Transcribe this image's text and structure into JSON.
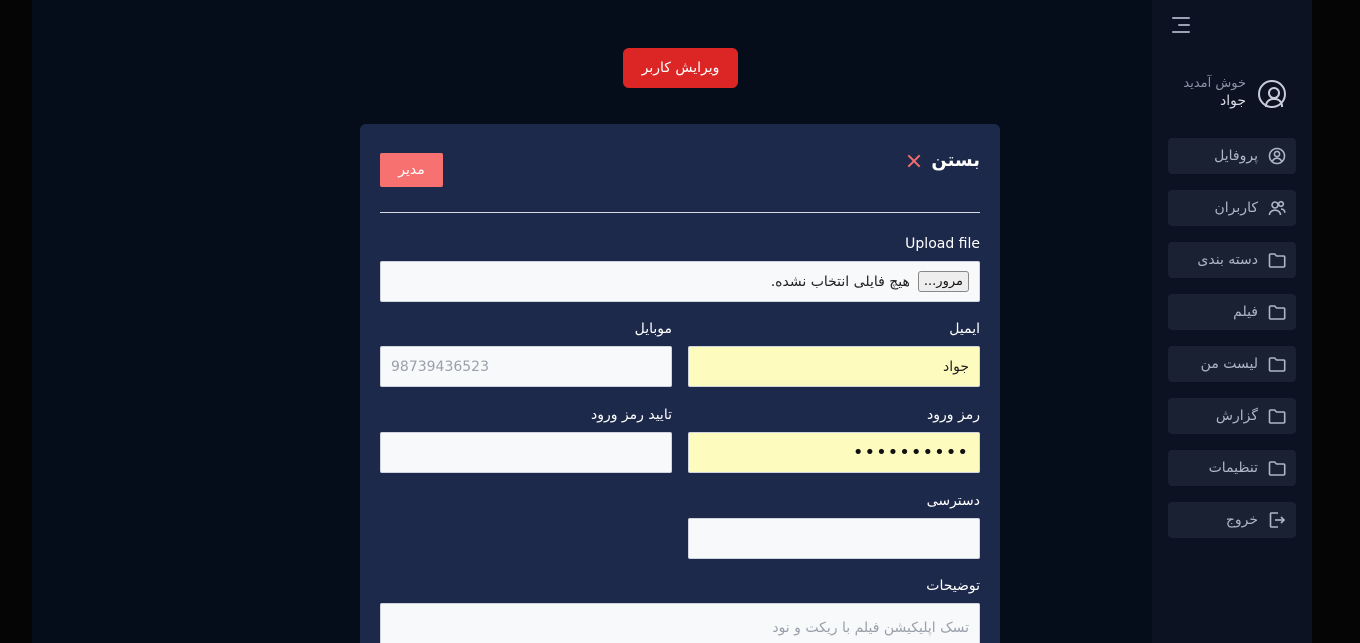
{
  "header": {
    "edit_user_label": "ویرایش کاربر"
  },
  "modal": {
    "close_label": "بستن",
    "role_badge": "مدیر",
    "upload": {
      "label": "Upload file",
      "browse_label": "مرور...",
      "no_file_text": "هیچ فایلی انتخاب نشده."
    },
    "email": {
      "label": "ایمیل",
      "value": "جواد"
    },
    "mobile": {
      "label": "موبایل",
      "placeholder": "98739436523"
    },
    "password": {
      "label": "رمز ورود",
      "value": "••••••••••"
    },
    "confirm_password": {
      "label": "تایید رمز ورود",
      "value": ""
    },
    "access": {
      "label": "دسترسی",
      "value": ""
    },
    "description": {
      "label": "توضیحات",
      "placeholder": "تسک اپلیکیشن فیلم با ریکت و نود"
    }
  },
  "sidebar": {
    "welcome_text": "خوش آمدید",
    "user_name": "جواد",
    "items": [
      {
        "label": "پروفایل",
        "icon": "profile-icon"
      },
      {
        "label": "کاربران",
        "icon": "users-icon"
      },
      {
        "label": "دسته بندی",
        "icon": "folder-icon"
      },
      {
        "label": "فیلم",
        "icon": "folder-icon"
      },
      {
        "label": "لیست من",
        "icon": "folder-icon"
      },
      {
        "label": "گزارش",
        "icon": "folder-icon"
      },
      {
        "label": "تنظیمات",
        "icon": "folder-icon"
      },
      {
        "label": "خروج",
        "icon": "logout-icon"
      }
    ]
  },
  "colors": {
    "accent_red": "#dc2626",
    "badge_red": "#f87171",
    "modal_bg": "#1d294a",
    "autofill_yellow": "#fefbbf"
  }
}
